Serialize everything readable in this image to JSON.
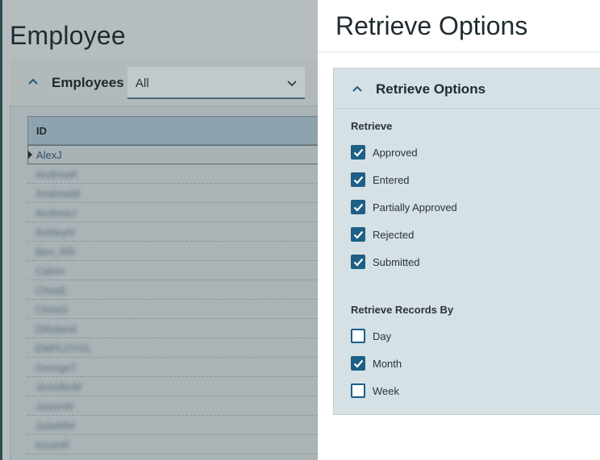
{
  "background": {
    "page_title": "Employee",
    "panel_label": "Employees",
    "filter_value": "All",
    "grid_header": "ID",
    "first_row": "AlexJ",
    "blurred_rows": [
      "AndrewK",
      "AndrewM",
      "AndrewJ",
      "AshleyN",
      "Ben_RR",
      "Calvin",
      "ChrisE",
      "ChrisG",
      "DRoland",
      "EMPLOY01",
      "GeorgeT",
      "JenniferM",
      "JasonW",
      "JulieMM",
      "KevinR"
    ]
  },
  "flyout": {
    "title": "Retrieve Options",
    "card_title": "Retrieve Options",
    "retrieve_label": "Retrieve",
    "retrieve_options": [
      {
        "label": "Approved",
        "checked": true
      },
      {
        "label": "Entered",
        "checked": true
      },
      {
        "label": "Partially Approved",
        "checked": true
      },
      {
        "label": "Rejected",
        "checked": true
      },
      {
        "label": "Submitted",
        "checked": true
      }
    ],
    "records_by_label": "Retrieve Records By",
    "records_by_options": [
      {
        "label": "Day",
        "checked": false
      },
      {
        "label": "Month",
        "checked": true
      },
      {
        "label": "Week",
        "checked": false
      }
    ]
  },
  "colors": {
    "accent": "#1d5f86",
    "card_bg": "#d5e1e4"
  }
}
